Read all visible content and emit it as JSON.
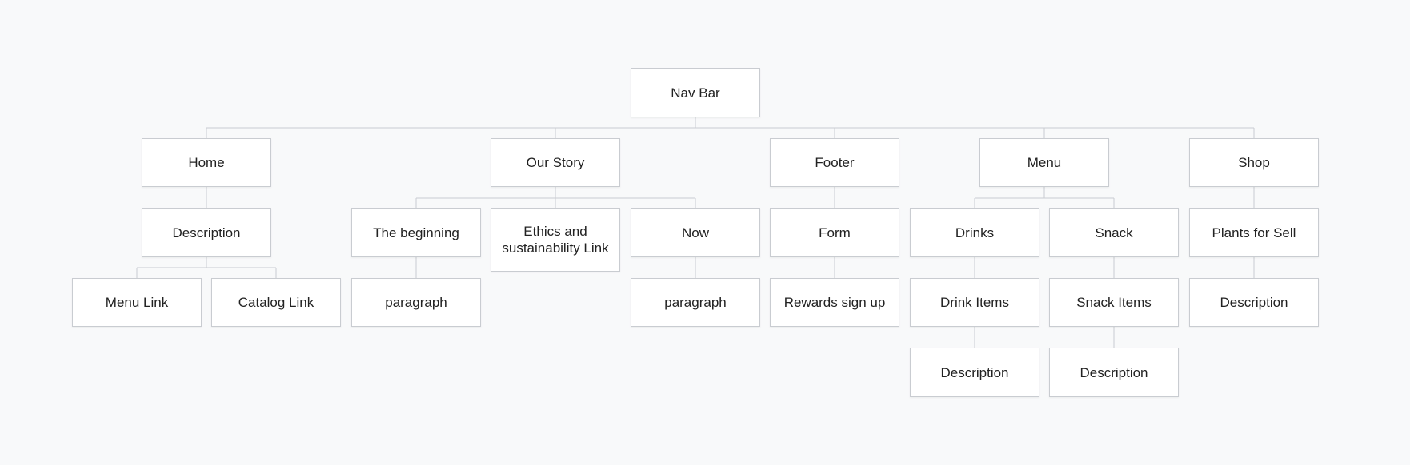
{
  "sitemap": {
    "root": "Nav Bar",
    "home": {
      "label": "Home",
      "description": "Description",
      "menu_link": "Menu Link",
      "catalog_link": "Catalog Link"
    },
    "our_story": {
      "label": "Our Story",
      "the_beginning": "The beginning",
      "the_beginning_paragraph": "paragraph",
      "ethics": "Ethics and sustainability Link",
      "now": "Now",
      "now_paragraph": "paragraph"
    },
    "footer": {
      "label": "Footer",
      "form": "Form",
      "rewards": "Rewards sign up"
    },
    "menu": {
      "label": "Menu",
      "drinks": "Drinks",
      "drink_items": "Drink Items",
      "drink_description": "Description",
      "snack": "Snack",
      "snack_items": "Snack Items",
      "snack_description": "Description"
    },
    "shop": {
      "label": "Shop",
      "plants": "Plants for Sell",
      "description": "Description"
    }
  },
  "colors": {
    "background": "#f8f9fa",
    "node_fill": "#ffffff",
    "node_border": "#c9ccd1",
    "connector": "#c9ccd1",
    "text": "#222222"
  }
}
